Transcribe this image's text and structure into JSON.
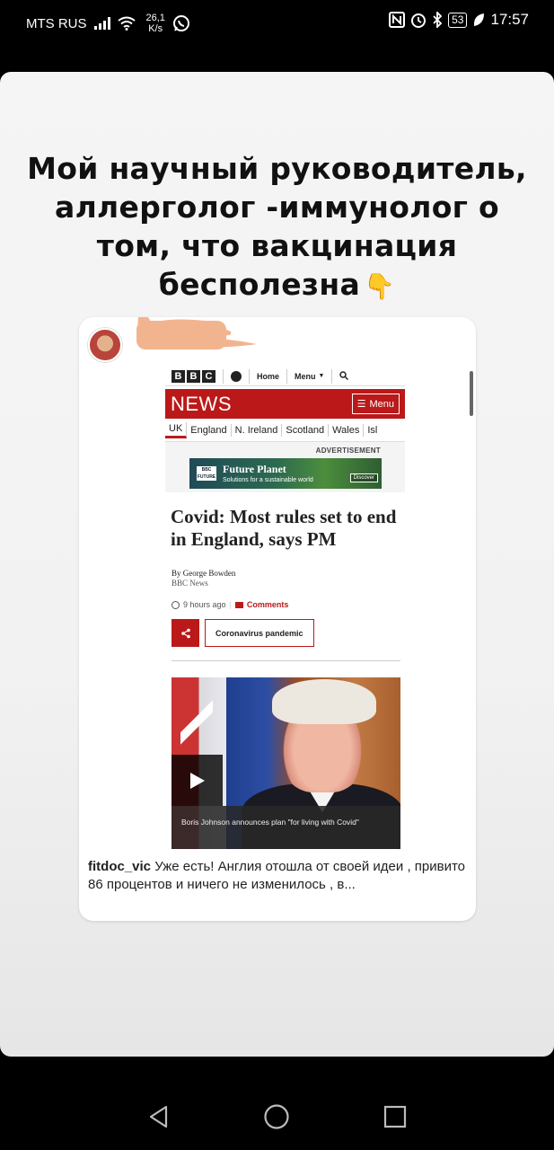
{
  "status_bar": {
    "carrier": "MTS RUS",
    "net_speed_value": "26,1",
    "net_speed_unit": "K/s",
    "battery": "53",
    "time": "17:57"
  },
  "story": {
    "headline_lines": [
      "Мой научный руководитель,",
      "аллерголог -иммунолог о",
      "том, что вакцинация",
      "бесполезна"
    ],
    "headline_emoji": "👇"
  },
  "post": {
    "bbc_page": {
      "logo_letters": [
        "B",
        "B",
        "C"
      ],
      "top_links": [
        "Home",
        "Menu"
      ],
      "news_label": "NEWS",
      "menu_label": "Menu",
      "nav_items": [
        "UK",
        "England",
        "N. Ireland",
        "Scotland",
        "Wales",
        "Isl"
      ],
      "advertisement_label": "ADVERTISEMENT",
      "ad": {
        "logo": "BBC FUTURE",
        "title": "Future Planet",
        "subtitle": "Solutions for a sustainable world",
        "button": "Discover"
      },
      "article_title": "Covid: Most rules set to end in England, says PM",
      "author": "By George Bowden",
      "source": "BBC News",
      "time_ago": "9 hours ago",
      "comments_label": "Comments",
      "topic_button": "Coronavirus pandemic",
      "video_caption": "Boris Johnson announces plan \"for living with Covid\""
    },
    "comment": {
      "username": "fitdoc_vic",
      "text": " Уже есть! Англия отошла от своей идеи , привито 86 процентов и ничего не изменилось , в..."
    }
  },
  "colors": {
    "bbc_red": "#bb1919",
    "redaction": "#f2b48f"
  }
}
